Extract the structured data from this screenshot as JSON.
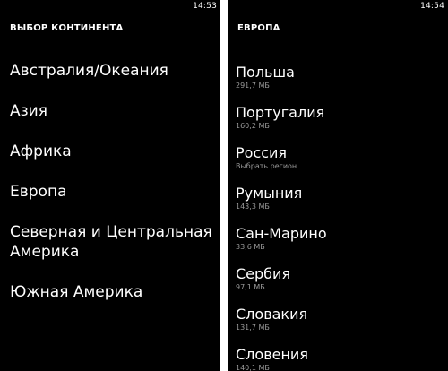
{
  "left_screen": {
    "status_time": "14:53",
    "header": "ВЫБОР КОНТИНЕНТА",
    "continents": [
      {
        "label": "Австралия/Океания"
      },
      {
        "label": "Азия"
      },
      {
        "label": "Африка"
      },
      {
        "label": "Европа"
      },
      {
        "label": "Северная и Центральная Америка"
      },
      {
        "label": "Южная Америка"
      }
    ]
  },
  "right_screen": {
    "status_time": "14:54",
    "header": "ЕВРОПА",
    "countries": [
      {
        "name": "Польша",
        "info": "291,7 МБ"
      },
      {
        "name": "Португалия",
        "info": "160,2 МБ"
      },
      {
        "name": "Россия",
        "info": "Выбрать регион"
      },
      {
        "name": "Румыния",
        "info": "143,3 МБ"
      },
      {
        "name": "Сан-Марино",
        "info": "33,6 МБ"
      },
      {
        "name": "Сербия",
        "info": "97,1 МБ"
      },
      {
        "name": "Словакия",
        "info": "131,7 МБ"
      },
      {
        "name": "Словения",
        "info": "140,1 МБ"
      }
    ]
  },
  "colors": {
    "background": "#000000",
    "text": "#ffffff",
    "secondary_text": "#9a9a9a",
    "divider": "#ffffff"
  }
}
